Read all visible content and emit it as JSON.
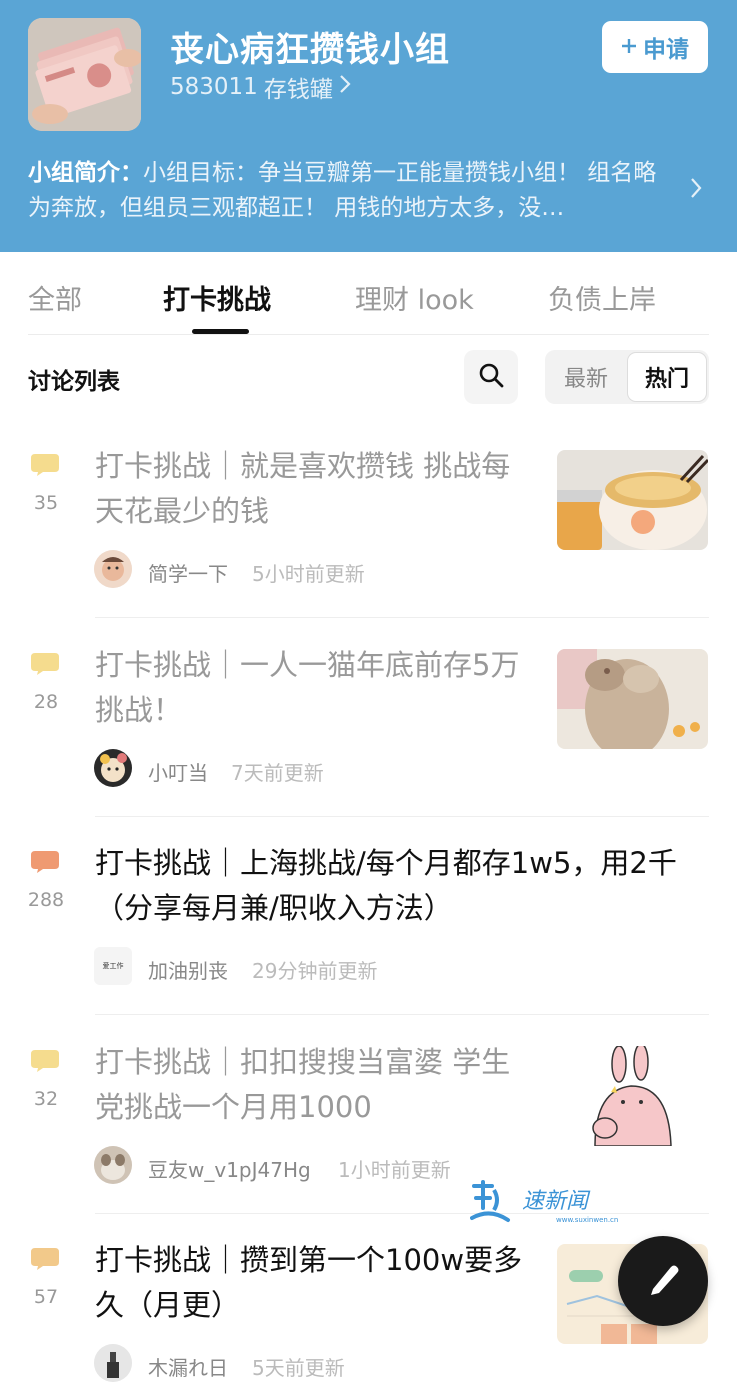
{
  "group": {
    "title": "丧心病狂攒钱小组",
    "member_count": "583011",
    "member_label": "存钱罐",
    "apply_label": "申请",
    "intro_label": "小组简介：",
    "intro_text": "小组目标：争当豆瓣第一正能量攒钱小组！ 组名略为奔放，但组员三观都超正！ 用钱的地方太多，没…"
  },
  "tabs": [
    "全部",
    "打卡挑战",
    "理财 look",
    "负债上岸"
  ],
  "active_tab": "打卡挑战",
  "list": {
    "title": "讨论列表",
    "sort_new": "最新",
    "sort_hot": "热门"
  },
  "posts": [
    {
      "count": "35",
      "title": "打卡挑战｜就是喜欢攒钱 挑战每天花最少的钱",
      "author": "简学一下",
      "updated": "5小时前更新",
      "read": true,
      "bubble_color": "#f5dc8e",
      "thumb": "food-bowl"
    },
    {
      "count": "28",
      "title": "打卡挑战｜一人一猫年底前存5万挑战！",
      "author": "小叮当",
      "updated": "7天前更新",
      "read": true,
      "bubble_color": "#f5dc8e",
      "thumb": "cat-paw"
    },
    {
      "count": "288",
      "title": "打卡挑战｜上海挑战/每个月都存1w5，用2千（分享每月兼/职收入方法）",
      "author": "加油别丧",
      "updated": "29分钟前更新",
      "read": false,
      "bubble_color": "#ef9a72",
      "thumb": null,
      "avatar_text": "爱工作"
    },
    {
      "count": "32",
      "title": "打卡挑战｜扣扣搜搜当富婆 学生党挑战一个月用1000",
      "author": "豆友w_v1pJ47Hg",
      "updated": "1小时前更新",
      "read": true,
      "bubble_color": "#f5dc8e",
      "thumb": "bunny-sticker"
    },
    {
      "count": "57",
      "title": "打卡挑战｜攒到第一个100w要多久（月更）",
      "author": "木漏れ日",
      "updated": "5天前更新",
      "read": false,
      "bubble_color": "#f2c98a",
      "thumb": "chart-card"
    }
  ],
  "watermark": {
    "brand": "速新闻",
    "url": "www.suxinwen.cn"
  },
  "icons": [
    "chevron-right-icon",
    "plus-icon",
    "search-icon",
    "comment-bubble-icon",
    "pencil-icon"
  ],
  "colors": {
    "header_bg": "#5aa5d5",
    "accent": "#4a9ad0",
    "fab": "#1a1a1a"
  }
}
